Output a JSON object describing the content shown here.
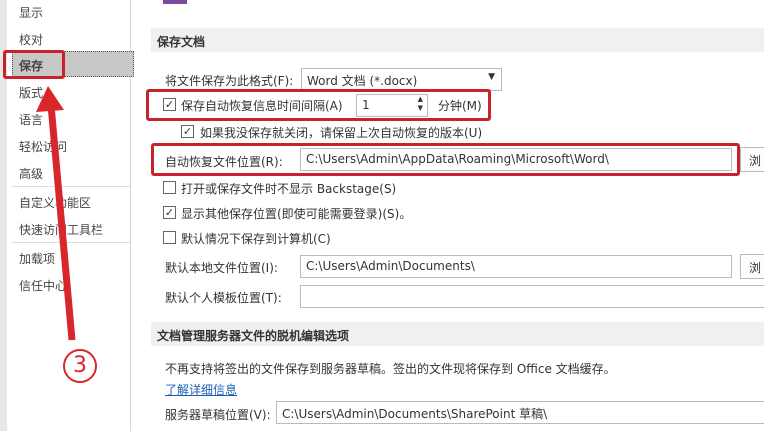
{
  "sidebar": {
    "items": [
      "显示",
      "校对",
      "保存",
      "版式",
      "语言",
      "轻松访问",
      "高级",
      "自定义功能区",
      "快速访问工具栏",
      "加载项",
      "信任中心"
    ],
    "selected": "保存"
  },
  "save_docs": {
    "header": "保存文档",
    "format_label": "将文件保存为此格式(F):",
    "format_value": "Word 文档 (*.docx)",
    "autosave_label": "保存自动恢复信息时间间隔(A)",
    "autosave_minutes": "1",
    "minutes_unit": "分钟(M)",
    "keep_last_label": "如果我没保存就关闭，请保留上次自动恢复的版本(U)",
    "autorecover_label": "自动恢复文件位置(R):",
    "autorecover_path": "C:\\Users\\Admin\\AppData\\Roaming\\Microsoft\\Word\\",
    "browse": "浏",
    "no_backstage_label": "打开或保存文件时不显示 Backstage(S)",
    "show_other_label": "显示其他保存位置(即使可能需要登录)(S)。",
    "save_to_computer_label": "默认情况下保存到计算机(C)",
    "default_local_label": "默认本地文件位置(I):",
    "default_local_path": "C:\\Users\\Admin\\Documents\\",
    "template_label": "默认个人模板位置(T):",
    "template_path": ""
  },
  "offline": {
    "header": "文档管理服务器文件的脱机编辑选项",
    "note": "不再支持将签出的文件保存到服务器草稿。签出的文件现将保存到 Office 文档缓存。",
    "learn_more": "了解详细信息",
    "drafts_label": "服务器草稿位置(V):",
    "drafts_path": "C:\\Users\\Admin\\Documents\\SharePoint 草稿\\"
  },
  "annotation": {
    "step": "3"
  }
}
